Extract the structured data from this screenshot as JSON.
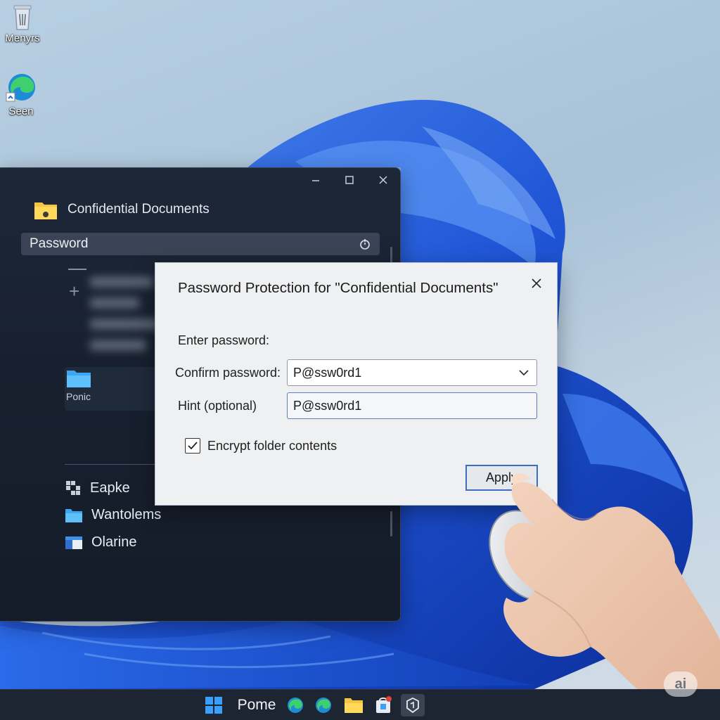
{
  "desktop": {
    "icons": [
      {
        "label": "Menyrs",
        "icon": "recycle-bin-icon"
      },
      {
        "label": "Seen",
        "icon": "edge-icon"
      }
    ]
  },
  "explorer": {
    "title": "Confidential Documents",
    "address": "Password",
    "folder_tile_label": "Ponic",
    "nav_items": [
      {
        "label": "Eapke",
        "icon": "apps-grid-icon"
      },
      {
        "label": "Wantolems",
        "icon": "folder-icon"
      },
      {
        "label": "Olarine",
        "icon": "window-icon"
      }
    ]
  },
  "dialog": {
    "title": "Password Protection for \"Confidential Documents\"",
    "enter_password_label": "Enter password:",
    "confirm_password_label": "Confirm password:",
    "confirm_password_value": "P@ssw0rd1",
    "hint_label": "Hint (optional)",
    "hint_value": "P@ssw0rd1",
    "encrypt_label": "Encrypt folder contents",
    "encrypt_checked": true,
    "apply_label": "Apply"
  },
  "taskbar": {
    "label": "Pome",
    "items": [
      "start-icon",
      "edge-icon",
      "edge-icon",
      "file-explorer-icon",
      "store-icon",
      "settings-icon"
    ]
  },
  "watermark": "ai",
  "colors": {
    "accent": "#3c6fc4",
    "explorer_bg": "#18202f",
    "dialog_bg": "#eef0f2",
    "wallpaper_bloom": "#1f55d6"
  }
}
